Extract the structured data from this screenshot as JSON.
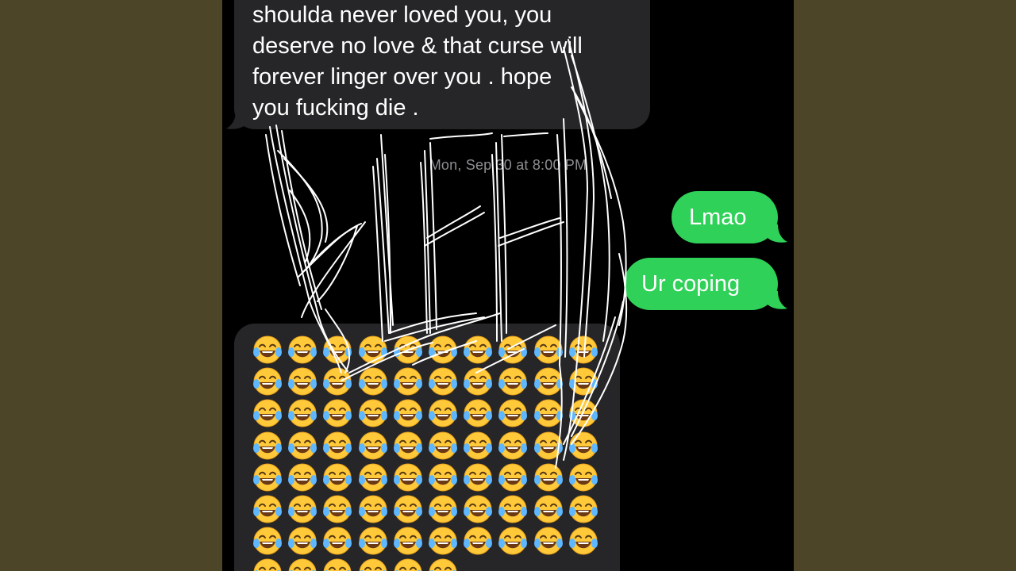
{
  "conversation": {
    "received_message_lines": [
      "shoulda never loved you, you",
      "deserve no love & that curse will",
      "forever linger over you . hope",
      "you fucking die ."
    ],
    "timestamp": "Mon, Sep 30 at 8:00 PM",
    "sent_messages": [
      {
        "text": "Lmao"
      },
      {
        "text": "Ur coping"
      }
    ],
    "emoji_message": {
      "emoji_name": "face-with-tears-of-joy",
      "count": 76
    }
  },
  "overlay": {
    "scribble_text": "BLEED",
    "scribble_color": "#ffffff"
  },
  "colors": {
    "background": "#4d4527",
    "screen": "#000000",
    "received_bubble": "#262628",
    "sent_bubble": "#2fd158",
    "timestamp": "#8e8e93"
  }
}
